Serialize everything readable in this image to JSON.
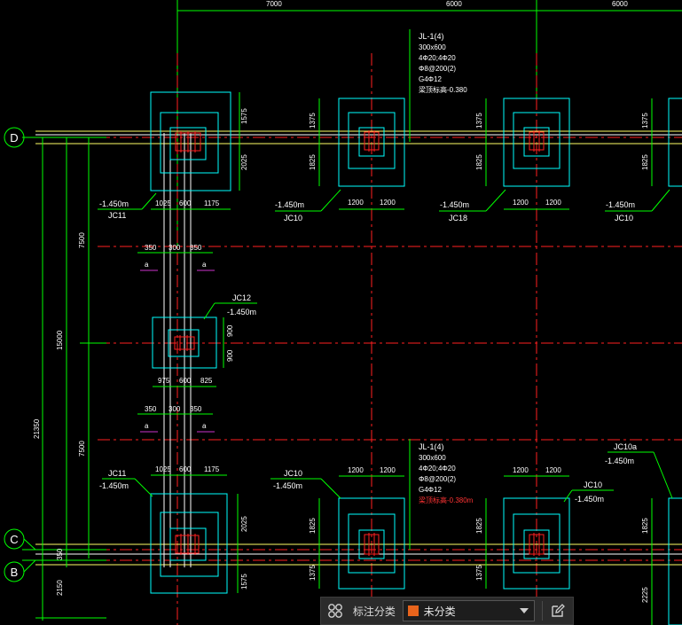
{
  "top_dims": [
    "7000",
    "6000",
    "6000"
  ],
  "grid_axes": [
    "D",
    "C",
    "B"
  ],
  "left_dims": {
    "d1": "7500",
    "d2": "7500",
    "total": "15000",
    "overall": "21350",
    "cb": "350",
    "b_down": "2150"
  },
  "beam_top": {
    "name": "JL-1(4)",
    "size": "300x600",
    "bars": "4Φ20;4Φ20",
    "stirrup": "Φ8@200(2)",
    "side": "G4Φ12",
    "elev": "梁顶标高-0.380"
  },
  "beam_bottom": {
    "name": "JL-1(4)",
    "size": "300x600",
    "bars": "4Φ20;4Φ20",
    "stirrup": "Φ8@200(2)",
    "side": "G4Φ12",
    "elev": "梁顶标高-0.380m"
  },
  "footings": {
    "jc11_top": {
      "name": "JC11",
      "elev": "-1.450m",
      "dims": [
        "1025",
        "600",
        "1175"
      ],
      "vdims": [
        "1575",
        "2025"
      ]
    },
    "jc10_top": {
      "name": "JC10",
      "elev": "-1.450m",
      "dims": [
        "1200",
        "1200"
      ],
      "vdims": [
        "1375",
        "1825"
      ]
    },
    "jc18_top": {
      "name": "JC18",
      "elev": "-1.450m",
      "dims": [
        "1200",
        "1200"
      ],
      "vdims": [
        "1375",
        "1825"
      ]
    },
    "jc10_top_r": {
      "name": "JC10",
      "elev": "-1.450m",
      "vdims": [
        "1375",
        "1825"
      ]
    },
    "jc12": {
      "name": "JC12",
      "elev": "-1.450m",
      "dims": [
        "975",
        "600",
        "825"
      ],
      "vdims": [
        "900",
        "900"
      ]
    },
    "jc11_bot": {
      "name": "JC11",
      "elev": "-1.450m",
      "dims": [
        "1025",
        "600",
        "1175"
      ],
      "vdims": [
        "2025",
        "1575"
      ]
    },
    "jc10_bot": {
      "name": "JC10",
      "elev": "-1.450m",
      "dims": [
        "1200",
        "1200"
      ],
      "vdims": [
        "1825",
        "1375"
      ]
    },
    "jc10_bot2": {
      "name": "JC10",
      "elev": "-1.450m",
      "dims": [
        "1200",
        "1200"
      ],
      "vdims": [
        "1825",
        "1375"
      ]
    },
    "jc10a": {
      "name": "JC10a",
      "elev": "-1.450m",
      "vdims": [
        "1825",
        "2225"
      ]
    }
  },
  "strip_dims": {
    "upper": [
      "350",
      "300",
      "350"
    ],
    "lower": [
      "350",
      "300",
      "350"
    ],
    "section": "a"
  },
  "toolbar": {
    "label": "标注分类",
    "dropdown_value": "未分类",
    "swatch_color": "#e8641c"
  }
}
